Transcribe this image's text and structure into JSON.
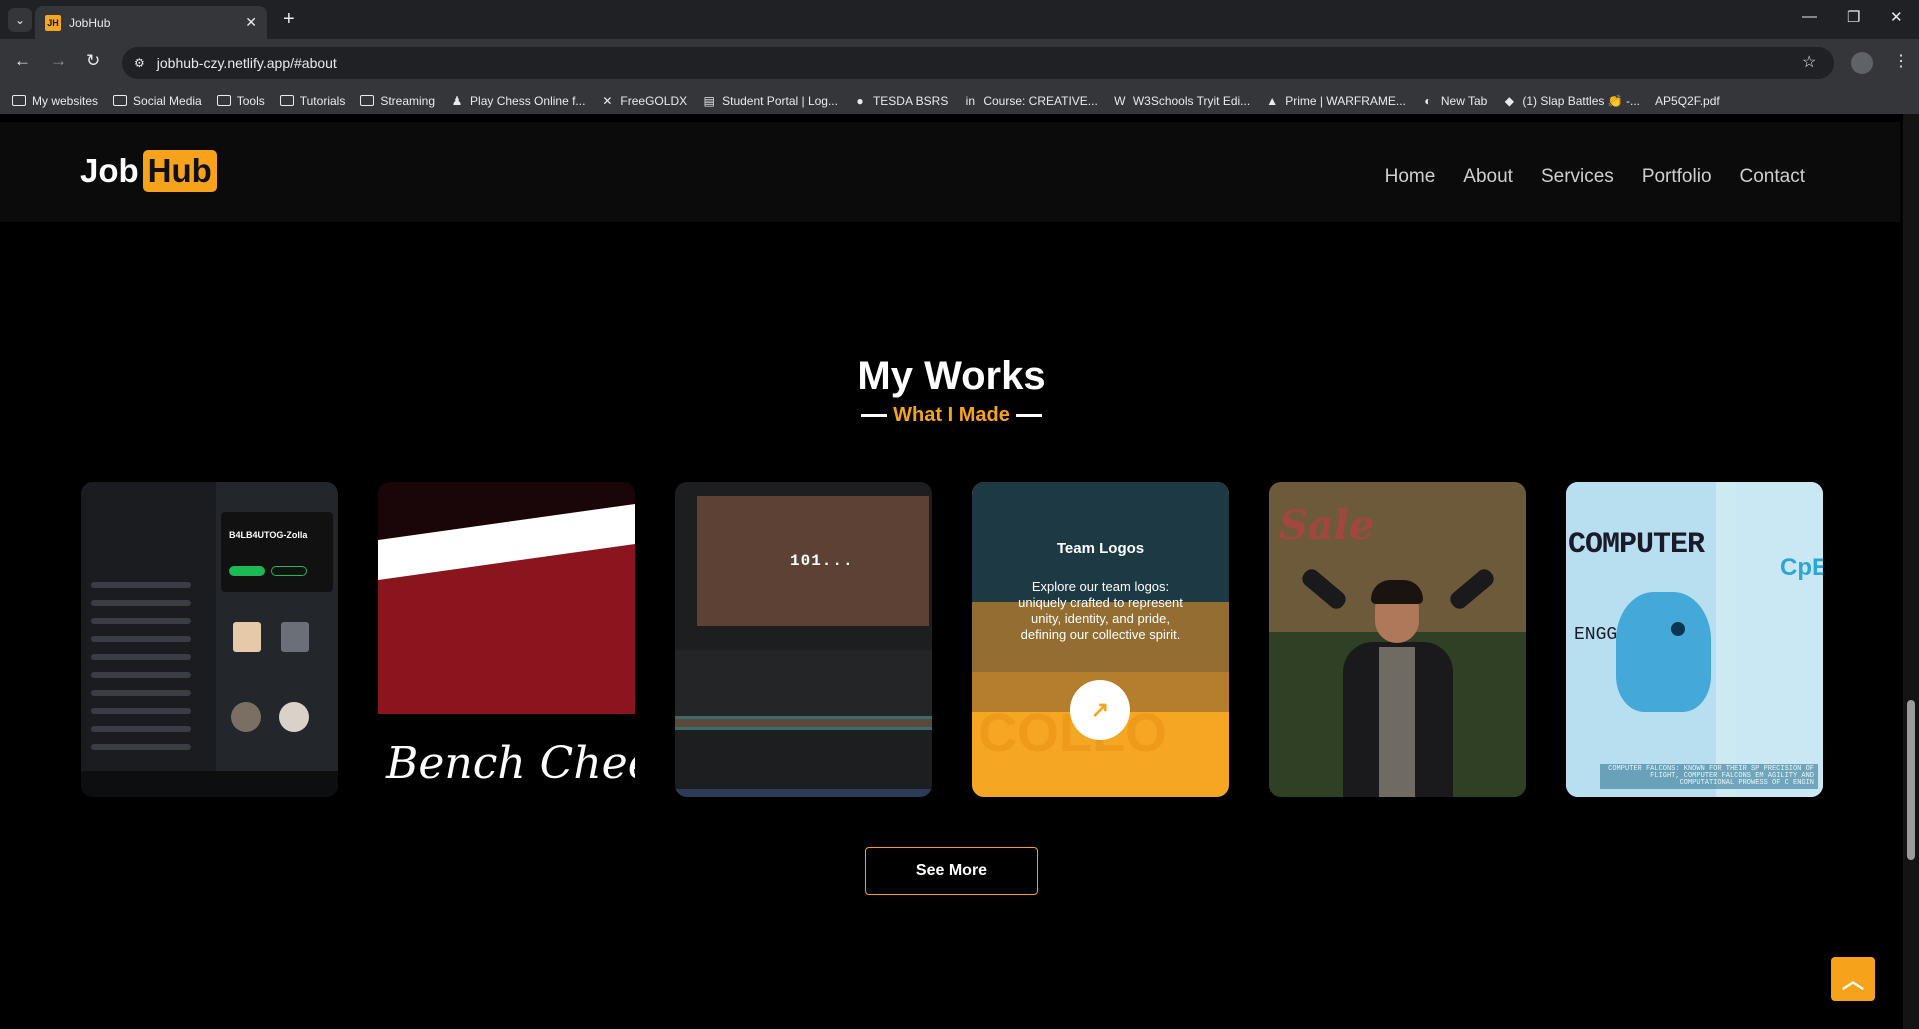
{
  "browser": {
    "tab_title": "JobHub",
    "tab_favicon_text": "JH",
    "url": "jobhub-czy.netlify.app/#about",
    "bookmarks": [
      {
        "label": "My websites",
        "icon": "folder-icon"
      },
      {
        "label": "Social Media",
        "icon": "folder-icon"
      },
      {
        "label": "Tools",
        "icon": "folder-icon"
      },
      {
        "label": "Tutorials",
        "icon": "folder-icon"
      },
      {
        "label": "Streaming",
        "icon": "folder-icon"
      },
      {
        "label": "Play Chess Online f...",
        "icon": "chess-pawn-icon"
      },
      {
        "label": "FreeGOLDX",
        "icon": "x-logo-icon"
      },
      {
        "label": "Student Portal | Log...",
        "icon": "page-icon"
      },
      {
        "label": "TESDA BSRS",
        "icon": "globe-icon"
      },
      {
        "label": "Course: CREATIVE...",
        "icon": "course-icon"
      },
      {
        "label": "W3Schools Tryit Edi...",
        "icon": "w3schools-icon"
      },
      {
        "label": "Prime | WARFRAME...",
        "icon": "prime-icon"
      },
      {
        "label": "New Tab",
        "icon": "newtab-icon"
      },
      {
        "label": "(1) Slap Battles 👏 -...",
        "icon": "roblox-icon"
      },
      {
        "label": "AP5Q2F.pdf",
        "icon": ""
      }
    ]
  },
  "site": {
    "logo_job": "Job",
    "logo_hub": "Hub",
    "nav": [
      "Home",
      "About",
      "Services",
      "Portfolio",
      "Contact"
    ],
    "accent": "#f7a21b",
    "section_title": "My Works",
    "section_subtitle": "What I Made",
    "cards": {
      "music_app": {
        "title": "B4LB4UTOG-Zolla"
      },
      "bench": {
        "caption": "Bench Cheering"
      },
      "editor": {
        "viewer_text": "101..."
      },
      "team_logos": {
        "title": "Team Logos",
        "description": "Explore our team logos: uniquely crafted to represent unity, identity, and pride, defining our collective spirit.",
        "link_icon": "external-link-icon"
      },
      "shirt": {
        "word": "COMPUTER",
        "badge": "CpE",
        "vertical": "ENGG"
      }
    },
    "see_more": "See More",
    "to_top_icon": "chevron-up-icon"
  }
}
